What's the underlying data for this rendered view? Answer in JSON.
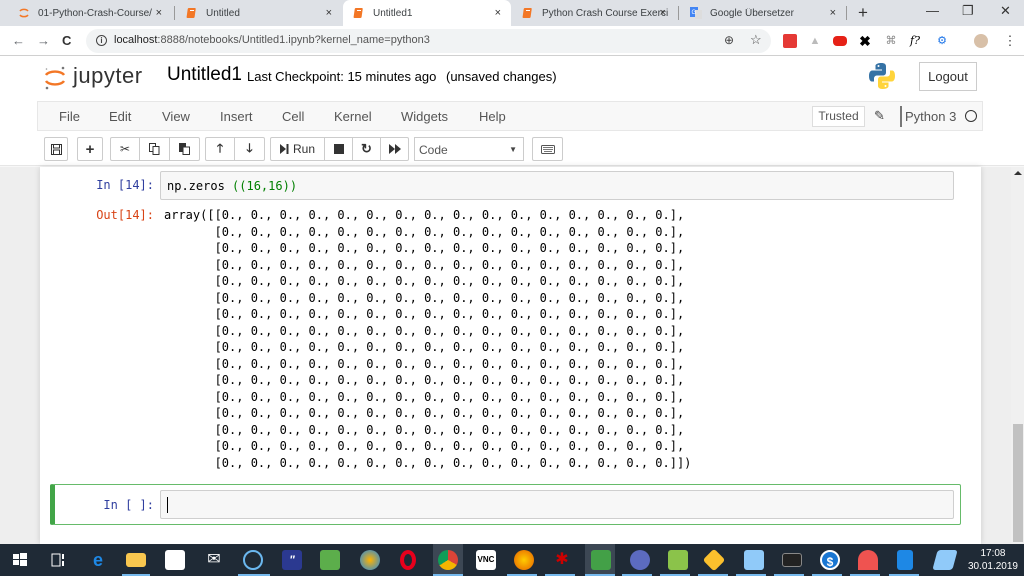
{
  "browser": {
    "tabs": [
      {
        "label": "01-Python-Crash-Course/",
        "icon": "jupyter-icon",
        "active": false
      },
      {
        "label": "Untitled",
        "icon": "notebook-icon",
        "active": false
      },
      {
        "label": "Untitled1",
        "icon": "notebook-icon",
        "active": true
      },
      {
        "label": "Python Crash Course Exerci",
        "icon": "notebook-icon",
        "active": false
      },
      {
        "label": "Google Übersetzer",
        "icon": "google-translate-icon",
        "active": false
      }
    ],
    "tab_close": "×",
    "new_tab": "+",
    "window_controls": {
      "minimize": "—",
      "maximize": "❐",
      "close": "✕"
    },
    "nav": {
      "back": "←",
      "forward": "→",
      "reload": "C"
    },
    "url_host": "localhost",
    "url_rest": ":8888/notebooks/Untitled1.ipynb?kernel_name=python3",
    "info_icon": "i",
    "zoom_icon": "⊕",
    "star_icon": "☆",
    "menu_icon": "⋮"
  },
  "jupyter": {
    "logo_text": "jupyter",
    "notebook_title": "Untitled1",
    "checkpoint": "Last Checkpoint: 15 minutes ago",
    "unsaved": "(unsaved changes)",
    "logout_label": "Logout",
    "menu": [
      "File",
      "Edit",
      "View",
      "Insert",
      "Cell",
      "Kernel",
      "Widgets",
      "Help"
    ],
    "trusted_label": "Trusted",
    "kernel_name": "Python 3",
    "toolbar": {
      "run_label": "Run",
      "cell_type": "Code",
      "cell_type_arrow": "▼"
    }
  },
  "cells": {
    "cell1": {
      "prompt": "In [14]:",
      "code_fn": "np.zeros ",
      "code_args": "((16,16))",
      "out_prompt": "Out[14]:",
      "output": "array([[0., 0., 0., 0., 0., 0., 0., 0., 0., 0., 0., 0., 0., 0., 0., 0.],\n       [0., 0., 0., 0., 0., 0., 0., 0., 0., 0., 0., 0., 0., 0., 0., 0.],\n       [0., 0., 0., 0., 0., 0., 0., 0., 0., 0., 0., 0., 0., 0., 0., 0.],\n       [0., 0., 0., 0., 0., 0., 0., 0., 0., 0., 0., 0., 0., 0., 0., 0.],\n       [0., 0., 0., 0., 0., 0., 0., 0., 0., 0., 0., 0., 0., 0., 0., 0.],\n       [0., 0., 0., 0., 0., 0., 0., 0., 0., 0., 0., 0., 0., 0., 0., 0.],\n       [0., 0., 0., 0., 0., 0., 0., 0., 0., 0., 0., 0., 0., 0., 0., 0.],\n       [0., 0., 0., 0., 0., 0., 0., 0., 0., 0., 0., 0., 0., 0., 0., 0.],\n       [0., 0., 0., 0., 0., 0., 0., 0., 0., 0., 0., 0., 0., 0., 0., 0.],\n       [0., 0., 0., 0., 0., 0., 0., 0., 0., 0., 0., 0., 0., 0., 0., 0.],\n       [0., 0., 0., 0., 0., 0., 0., 0., 0., 0., 0., 0., 0., 0., 0., 0.],\n       [0., 0., 0., 0., 0., 0., 0., 0., 0., 0., 0., 0., 0., 0., 0., 0.],\n       [0., 0., 0., 0., 0., 0., 0., 0., 0., 0., 0., 0., 0., 0., 0., 0.],\n       [0., 0., 0., 0., 0., 0., 0., 0., 0., 0., 0., 0., 0., 0., 0., 0.],\n       [0., 0., 0., 0., 0., 0., 0., 0., 0., 0., 0., 0., 0., 0., 0., 0.],\n       [0., 0., 0., 0., 0., 0., 0., 0., 0., 0., 0., 0., 0., 0., 0., 0.]])"
    },
    "cell2": {
      "prompt": "In [ ]:",
      "code": ""
    }
  },
  "colors": {
    "in_prompt": "#303f9f",
    "out_prompt": "#d84315",
    "selected_cell_border": "#42a548",
    "jupyter_orange": "#f37726"
  },
  "taskbar": {
    "time": "17:08",
    "date": "30.01.2019",
    "icons": [
      "windows-start-icon",
      "task-view-icon",
      "edge-icon",
      "file-explorer-icon",
      "store-icon",
      "mail-icon",
      "cortana-icon",
      "quotes-app-icon",
      "presentation-icon",
      "paint-icon",
      "opera-icon",
      "chrome-icon",
      "vnc-icon",
      "firefox-icon",
      "bug-icon",
      "calc-spreadsheet-icon",
      "scholar-icon",
      "drawing-icon",
      "archive-icon",
      "contacts-icon",
      "terminal-icon",
      "sync-icon",
      "snipping-tool-icon",
      "writer-icon",
      "notepad-icon"
    ]
  }
}
